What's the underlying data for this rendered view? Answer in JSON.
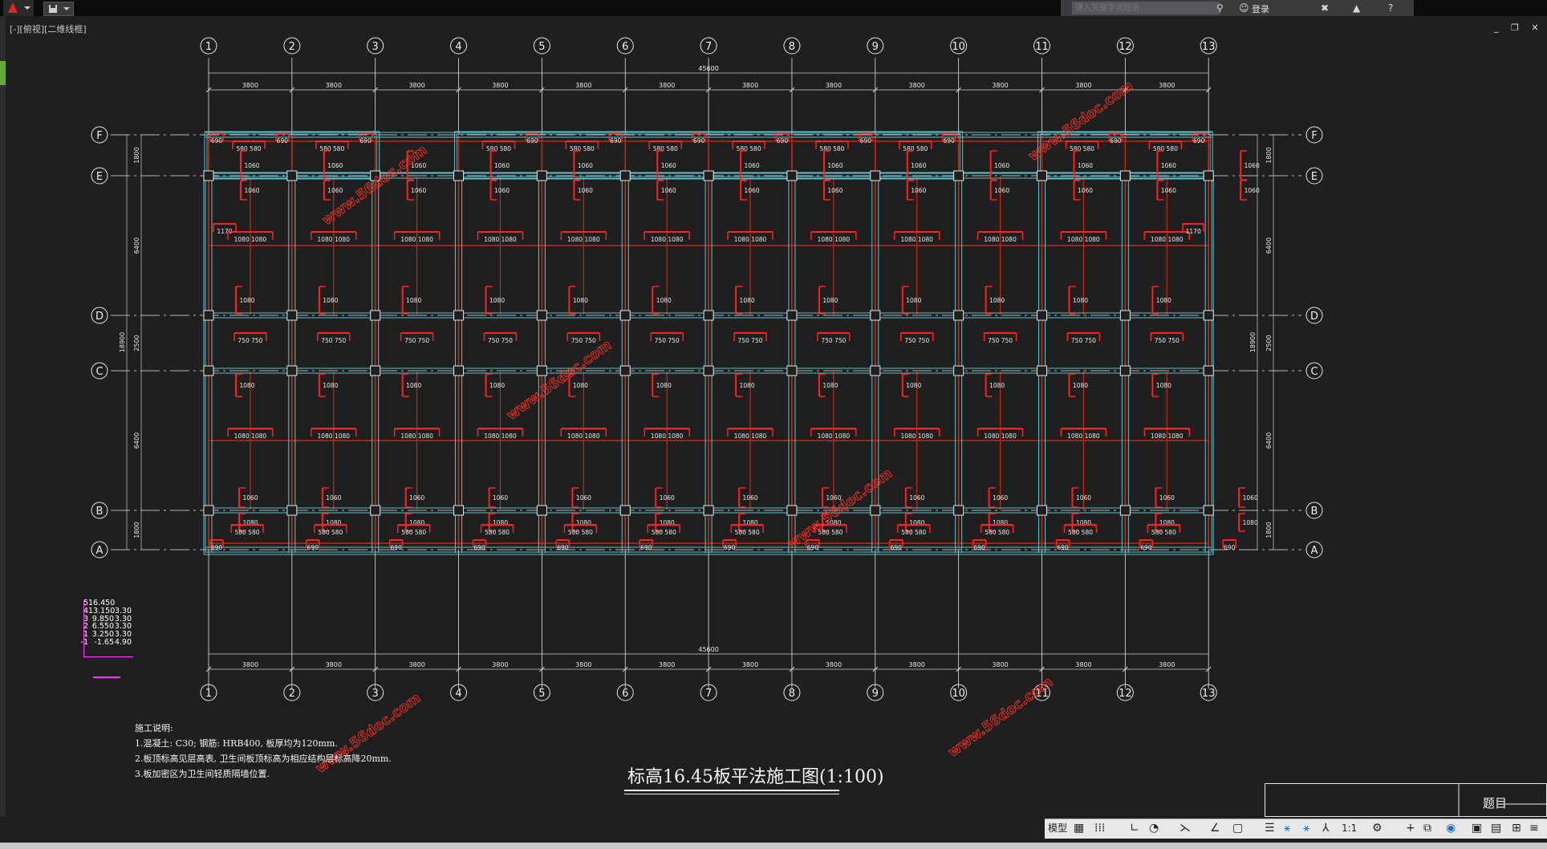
{
  "colors": {
    "background": "#1f1f1f",
    "grid_line": "#ffffff",
    "slab_cyan": "#57c6d0",
    "beam_red": "#c32a12",
    "rebar_red": "#ff2020",
    "level_magenta": "#ff30ff",
    "watermark": "#ff3020"
  },
  "toolbar": {
    "search_placeholder": "键入关键字或短语",
    "login_label": "登录"
  },
  "viewport_label": "[-][俯视][二维线框]",
  "window_controls": "_ ❐ ✕",
  "grid": {
    "columns": [
      "1",
      "2",
      "3",
      "4",
      "5",
      "6",
      "7",
      "8",
      "9",
      "10",
      "11",
      "12",
      "13"
    ],
    "rows": [
      "F",
      "E",
      "D",
      "C",
      "B",
      "A"
    ]
  },
  "dims": {
    "top_total": "45600",
    "bottom_total": "45600",
    "spans": [
      "3800",
      "3800",
      "3800",
      "3800",
      "3800",
      "3800",
      "3800",
      "3800",
      "3800",
      "3800",
      "3800",
      "3800"
    ],
    "left_total": "18900",
    "right_total": "18900",
    "left_parts": [
      "1800",
      "6400",
      "2500",
      "6400",
      "1800"
    ],
    "right_parts": [
      "1800",
      "6400",
      "2500",
      "6400",
      "1800"
    ]
  },
  "rebar_labels": [
    "690",
    "580 580",
    "1060",
    "1080",
    "1080 1080",
    "1170",
    "1150",
    "750 750",
    "1060",
    "1030"
  ],
  "watermark": "www.56doc.com",
  "levels": [
    {
      "n": "5",
      "elev": "16.450",
      "h": ""
    },
    {
      "n": "4",
      "elev": "13.150",
      "h": "3.30"
    },
    {
      "n": "3",
      "elev": "9.850",
      "h": "3.30"
    },
    {
      "n": "2",
      "elev": "6.550",
      "h": "3.30"
    },
    {
      "n": "1",
      "elev": "3.250",
      "h": "3.30"
    },
    {
      "n": "-1",
      "elev": "-1.65",
      "h": "4.90"
    }
  ],
  "notes": {
    "title": "施工说明:",
    "line1": "1.混凝土: C30; 钢筋: HRB400, 板厚均为120mm.",
    "line2": "2.板顶标高见层高表, 卫生间板顶标高为相应结构层标高降20mm.",
    "line3": "3.板加密区为卫生间轻质隔墙位置."
  },
  "drawing_title": "标高16.45板平法施工图(1:100)",
  "title_block_label": "题目",
  "statusbar": {
    "model_tab": "模型",
    "scale": "1:1"
  }
}
